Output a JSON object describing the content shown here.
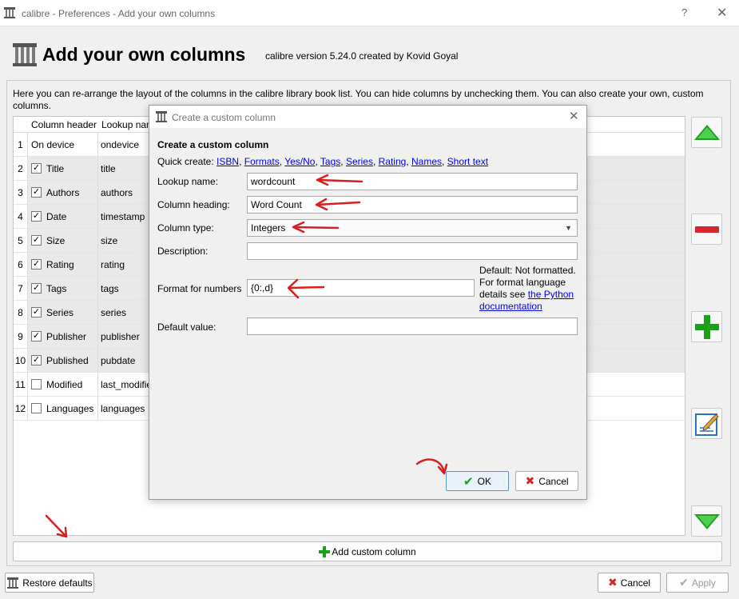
{
  "window": {
    "title": "calibre - Preferences - Add your own columns",
    "help_label": "?",
    "close_label": "✕"
  },
  "header": {
    "title": "Add your own columns",
    "subtitle": "calibre version 5.24.0 created by Kovid Goyal"
  },
  "description": "Here you can re-arrange the layout of the columns in the calibre library book list. You can hide columns by unchecking them. You can also create your own, custom columns.",
  "table": {
    "headers": [
      "Column header",
      "Lookup name"
    ],
    "rows": [
      {
        "num": "1",
        "header": "On device",
        "lookup": "ondevice",
        "checkbox": "none"
      },
      {
        "num": "2",
        "header": "Title",
        "lookup": "title",
        "checkbox": "checked"
      },
      {
        "num": "3",
        "header": "Authors",
        "lookup": "authors",
        "checkbox": "checked"
      },
      {
        "num": "4",
        "header": "Date",
        "lookup": "timestamp",
        "checkbox": "checked"
      },
      {
        "num": "5",
        "header": "Size",
        "lookup": "size",
        "checkbox": "checked"
      },
      {
        "num": "6",
        "header": "Rating",
        "lookup": "rating",
        "checkbox": "checked"
      },
      {
        "num": "7",
        "header": "Tags",
        "lookup": "tags",
        "checkbox": "checked"
      },
      {
        "num": "8",
        "header": "Series",
        "lookup": "series",
        "checkbox": "checked"
      },
      {
        "num": "9",
        "header": "Publisher",
        "lookup": "publisher",
        "checkbox": "checked"
      },
      {
        "num": "10",
        "header": "Published",
        "lookup": "pubdate",
        "checkbox": "checked"
      },
      {
        "num": "11",
        "header": "Modified",
        "lookup": "last_modified",
        "checkbox": "unchecked"
      },
      {
        "num": "12",
        "header": "Languages",
        "lookup": "languages",
        "checkbox": "unchecked"
      }
    ]
  },
  "side_buttons": [
    "move-up",
    "remove",
    "add",
    "edit",
    "move-down"
  ],
  "add_column_label": "Add custom column",
  "footer": {
    "restore_label": "Restore defaults",
    "cancel_label": "Cancel",
    "apply_label": "Apply"
  },
  "dialog": {
    "title": "Create a custom column",
    "heading": "Create a custom column",
    "quick_create_label": "Quick create:",
    "quick_links": [
      "ISBN",
      "Formats",
      "Yes/No",
      "Tags",
      "Series",
      "Rating",
      "Names",
      "Short text"
    ],
    "lookup_label": "Lookup name:",
    "lookup_value": "wordcount",
    "heading_label": "Column heading:",
    "heading_value": "Word Count",
    "type_label": "Column type:",
    "type_value": "Integers",
    "description_label": "Description:",
    "description_value": "",
    "format_label": "Format for numbers",
    "format_value": "{0:,d}",
    "format_help_prefix": "Default: Not formatted. For format language details see",
    "format_help_link": "the Python documentation",
    "default_label": "Default value:",
    "default_value": "",
    "ok_label": "OK",
    "cancel_label": "Cancel"
  },
  "colors": {
    "accent_green": "#1aa01a",
    "remove_red": "#d6262d",
    "annotation_red": "#d81e1e",
    "link_blue": "#0000ee"
  }
}
